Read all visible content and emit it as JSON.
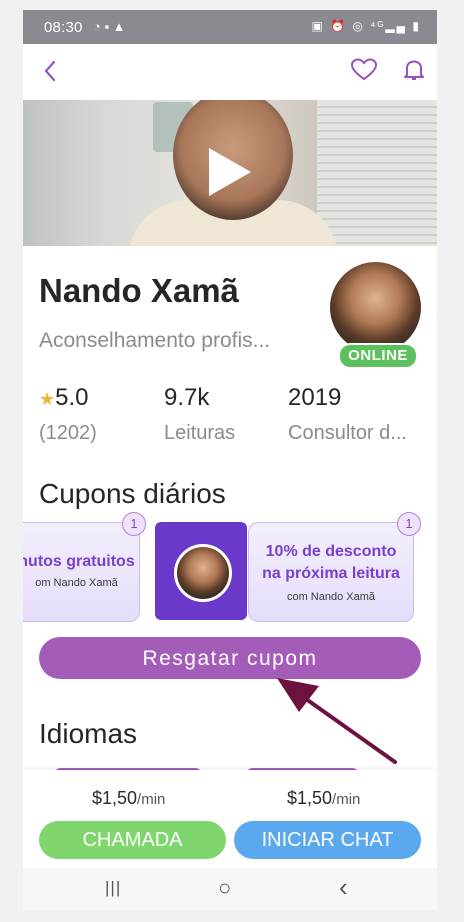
{
  "statusbar": {
    "time": "08:30",
    "left_icons": "◔ ▪ ▲",
    "right_icons": "▣ ⏰ ◎ ⁴ᴳ▂▄ ▮"
  },
  "header": {
    "back_icon": "chevron-left-icon",
    "favorite_icon": "heart-icon",
    "bell_icon": "bell-icon"
  },
  "profile": {
    "name": "Nando Xamã",
    "subtitle": "Aconselhamento profis...",
    "status": "ONLINE"
  },
  "stats": [
    {
      "value": "5.0",
      "label": "(1202)",
      "star": "★"
    },
    {
      "value": "9.7k",
      "label": "Leituras"
    },
    {
      "value": "2019",
      "label": "Consultor d..."
    }
  ],
  "coupons": {
    "title": "Cupons diários",
    "left": {
      "main": "nutos gratuitos",
      "sub": "om Nando Xamã",
      "badge": "1"
    },
    "right": {
      "main1": "10% de desconto",
      "main2": "na próxima leitura",
      "sub": "com Nando Xamã",
      "badge": "1"
    },
    "redeem_label": "Resgatar cupom"
  },
  "languages": {
    "title": "Idiomas"
  },
  "actions": {
    "call": {
      "price": "$1,50",
      "unit": "/min",
      "label": "CHAMADA"
    },
    "chat": {
      "price": "$1,50",
      "unit": "/min",
      "label": "INICIAR CHAT"
    }
  },
  "colors": {
    "accent": "#a45cb9",
    "call": "#7fd66c",
    "chat": "#5aa8ee",
    "online": "#5cc05f",
    "coupon_center": "#6a39c9"
  },
  "navbar": {
    "recents": "|||",
    "home": "○",
    "back": "‹"
  }
}
